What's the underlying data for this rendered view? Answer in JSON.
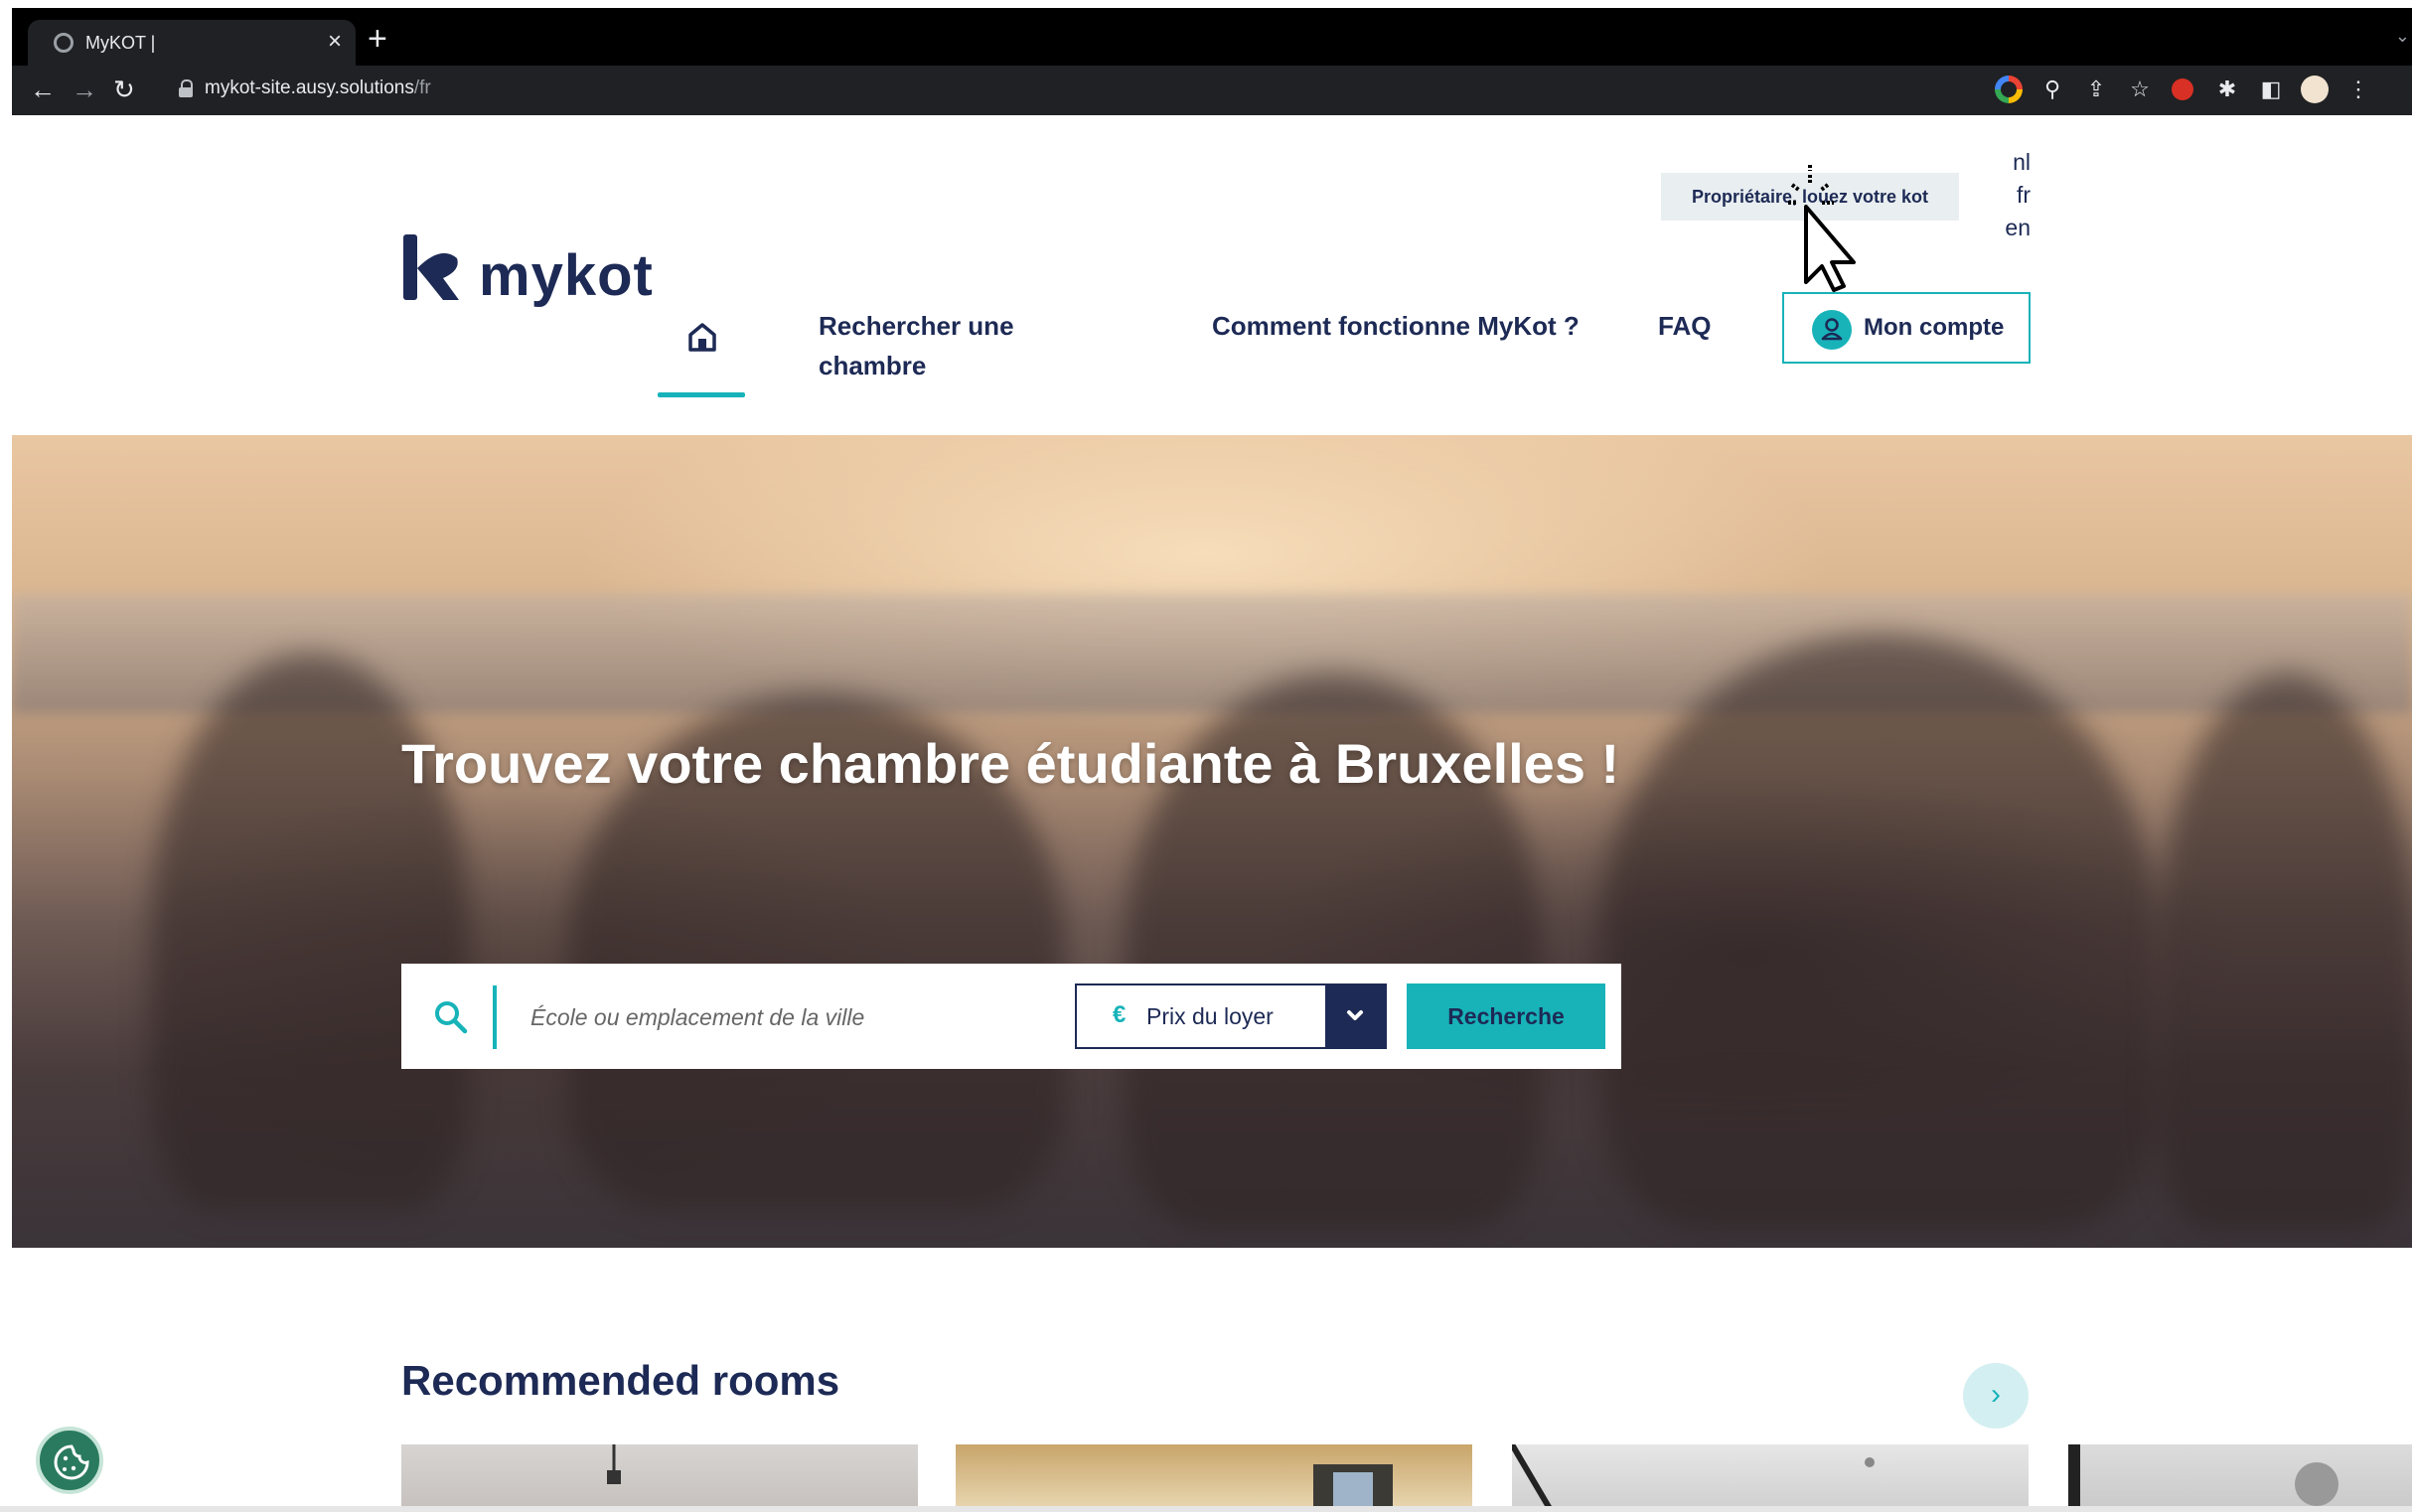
{
  "browser": {
    "tab_title": "MyKOT |",
    "tab_close": "×",
    "new_tab": "+",
    "url_host": "mykot-site.ausy.solutions",
    "url_path": "/fr",
    "icons": [
      "back-icon",
      "forward-icon",
      "reload-icon",
      "lock-icon",
      "google-icon",
      "zoom-icon",
      "share-icon",
      "star-icon",
      "extension-red-icon",
      "puzzle-icon",
      "sidepanel-icon",
      "profile-avatar-icon"
    ]
  },
  "header": {
    "owner_cta": "Propriétaire, louez votre kot",
    "languages": [
      "nl",
      "fr",
      "en"
    ],
    "logo_text": "mykot",
    "nav": {
      "search_room": "Rechercher une chambre",
      "how_it_works": "Comment fonctionne MyKot ?",
      "faq": "FAQ",
      "account": "Mon compte"
    }
  },
  "hero": {
    "title": "Trouvez votre chambre étudiante à Bruxelles !",
    "search_placeholder": "École ou emplacement de la ville",
    "price_symbol": "€",
    "price_label": "Prix du loyer",
    "search_button": "Recherche"
  },
  "recommended": {
    "title": "Recommended rooms",
    "next": "›"
  },
  "colors": {
    "brand_navy": "#1d2a55",
    "brand_teal": "#17b3b9"
  }
}
